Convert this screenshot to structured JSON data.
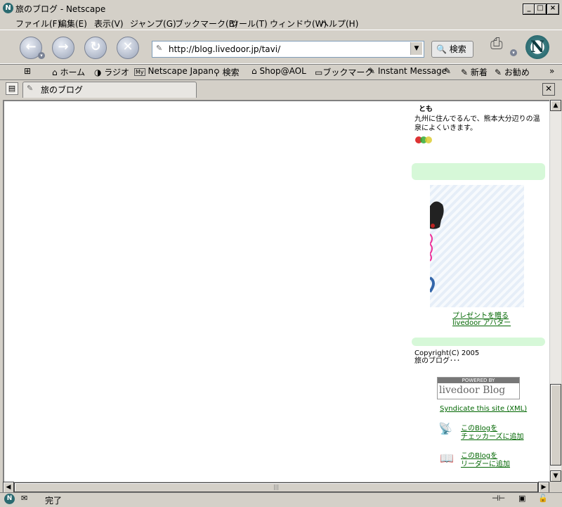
{
  "window": {
    "title": "旅のブログ - Netscape"
  },
  "menu": [
    "ファイル(F)",
    "編集(E)",
    "表示(V)",
    "ジャンプ(G)",
    "ブックマーク(B)",
    "ツール(T)",
    "ウィンドウ(W)",
    "ヘルプ(H)"
  ],
  "nav": {
    "url": "http://blog.livedoor.jp/tavi/",
    "search_label": "検索"
  },
  "bookmarks": [
    "ホーム",
    "ラジオ",
    "Netscape Japan",
    "検索",
    "Shop@AOL",
    "ブックマーク",
    "Instant Message",
    "新着",
    "お勧め"
  ],
  "tab": {
    "label": "旅のブログ"
  },
  "sidebar": {
    "author_name": "とも",
    "author_desc": "九州に住んでるんで、熊本大分辺りの温泉によくいきます。",
    "present_link": "プレゼントを贈る",
    "avatar_link": "livedoor アバター",
    "copyright_line1": "Copyright(C) 2005",
    "copyright_line2": "旅のブログ･･･",
    "powered_by": "POWERED BY",
    "logo_text": "livedoor Blog",
    "syndicate": "Syndicate this site (XML)",
    "checkers_line1": "このBlogを",
    "checkers_line2": "チェッカーズに追加",
    "reader_line1": "このBlogを",
    "reader_line2": "リーダーに追加"
  },
  "status": {
    "text": "完了"
  }
}
